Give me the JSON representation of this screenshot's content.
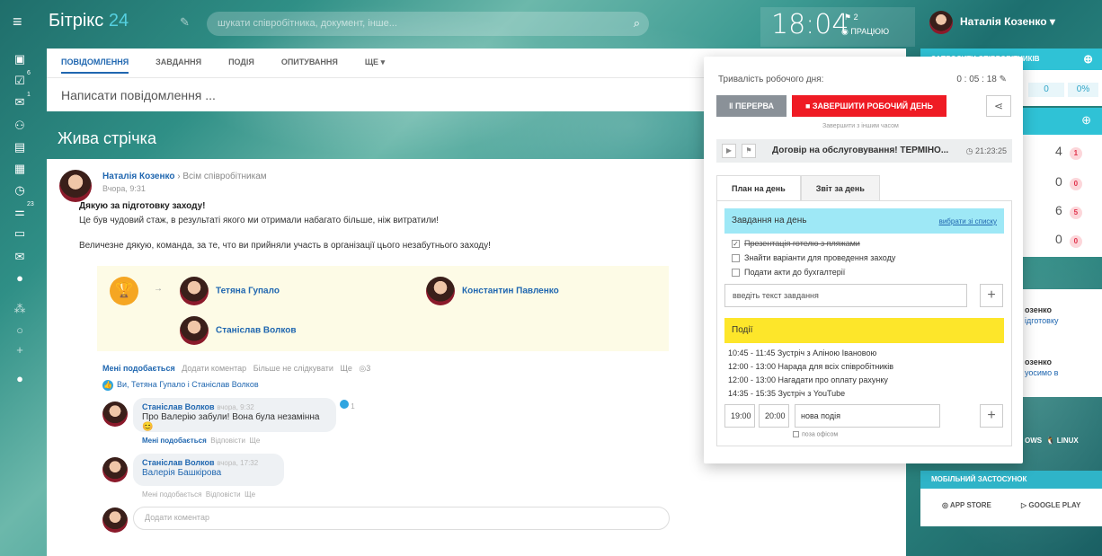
{
  "header": {
    "logo_main": "Бітрікс",
    "logo_num": "24",
    "search_placeholder": "шукати співробітника, документ, інше...",
    "time": "18:04",
    "flag_count": "2",
    "status": "ПРАЦЮЮ",
    "user_name": "Наталія Козенко"
  },
  "leftbar": {
    "counters": [
      "6",
      "1",
      "23"
    ]
  },
  "composer": {
    "tabs": [
      "ПОВІДОМЛЕННЯ",
      "ЗАВДАННЯ",
      "ПОДІЯ",
      "ОПИТУВАННЯ",
      "ЩЕ"
    ],
    "placeholder": "Написати повідомлення ..."
  },
  "feed": {
    "title": "Жива стрічка",
    "post": {
      "author": "Наталія Козенко",
      "recipient": "Всім співробітникам",
      "date": "Вчора, 9:31",
      "title": "Дякую за підготовку заходу!",
      "line1": "Це був чудовий стаж, в результаті якого ми отримали набагато більше, ніж витратили!",
      "line2": "Величезне дякую, команда, за те, что ви прийняли участь в організації цього незабутнього заходу!",
      "grat_people": [
        "Тетяна Гупало",
        "Константин Павленко",
        "Станіслав Волков"
      ],
      "actions": {
        "like": "Мені подобається",
        "comment": "Додати коментар",
        "unfollow": "Більше не слідкувати",
        "more": "Ще",
        "views": "3"
      },
      "likes_text": "Ви, Тетяна Гупало і Станіслав Волков"
    },
    "comments": [
      {
        "author": "Станіслав Волков",
        "date": "вчора, 9:32",
        "text": "Про Валерію забули! Вона була незамінна",
        "likes": "1",
        "like": "Мені подобається",
        "reply": "Відповісти",
        "more": "Ще"
      },
      {
        "author": "Станіслав Волков",
        "date": "вчора, 17:32",
        "text": "Валерія Башкірова",
        "like": "Мені подобається",
        "reply": "Відповісти",
        "more": "Ще"
      }
    ],
    "add_comment": "Додати коментар"
  },
  "popup": {
    "duration_label": "Тривалість робочого дня:",
    "duration": "0 : 05 : 18",
    "pause": "ПЕРЕРВА",
    "finish": "ЗАВЕРШИТИ РОБОЧИЙ ДЕНЬ",
    "finish_later": "Завершити з іншим часом",
    "task_title": "Договір на обслуговування! ТЕРМІНО...",
    "task_time": "21:23:25",
    "tab_plan": "План на день",
    "tab_report": "Звіт за день",
    "tasks_header": "Завдання на день",
    "choose_link": "вибрати зі списку",
    "tasks": [
      {
        "text": "Презентація готелю з пляжами",
        "done": true
      },
      {
        "text": "Знайти варіанти для проведення заходу",
        "done": false
      },
      {
        "text": "Подати акти до бухгалтерії",
        "done": false
      }
    ],
    "task_input": "введіть текст завдання",
    "events_header": "Події",
    "events": [
      "10:45 - 11:45  Зустріч з Аліною Івановою",
      "12:00 - 13:00  Нарада для всіх співробітників",
      "12:00 - 13:00  Нагадати про оплату рахунку",
      "14:35 - 15:35  Зустріч з YouTube"
    ],
    "ev_from": "19:00",
    "ev_to": "20:00",
    "ev_name": "нова подія",
    "ev_office": "поза офісом"
  },
  "right": {
    "invite": "ЗАПРОСИТИ СПІВРОБІТНИКІВ",
    "stat_value": "0",
    "stat_pct": "0%",
    "counts": [
      {
        "v": "4",
        "b": "1"
      },
      {
        "v": "0",
        "b": "0"
      },
      {
        "v": "6",
        "b": "5"
      },
      {
        "v": "0",
        "b": "0"
      }
    ],
    "news1_a": "озенко",
    "news1_b": "ідготовку",
    "news2_a": "озенко",
    "news2_b": "уосимо в",
    "os_partial": "OWS",
    "linux": "LINUX",
    "mobile": "МОБІЛЬНИЙ ЗАСТОСУНОК",
    "appstore": "APP STORE",
    "gplay": "GOOGLE PLAY"
  }
}
